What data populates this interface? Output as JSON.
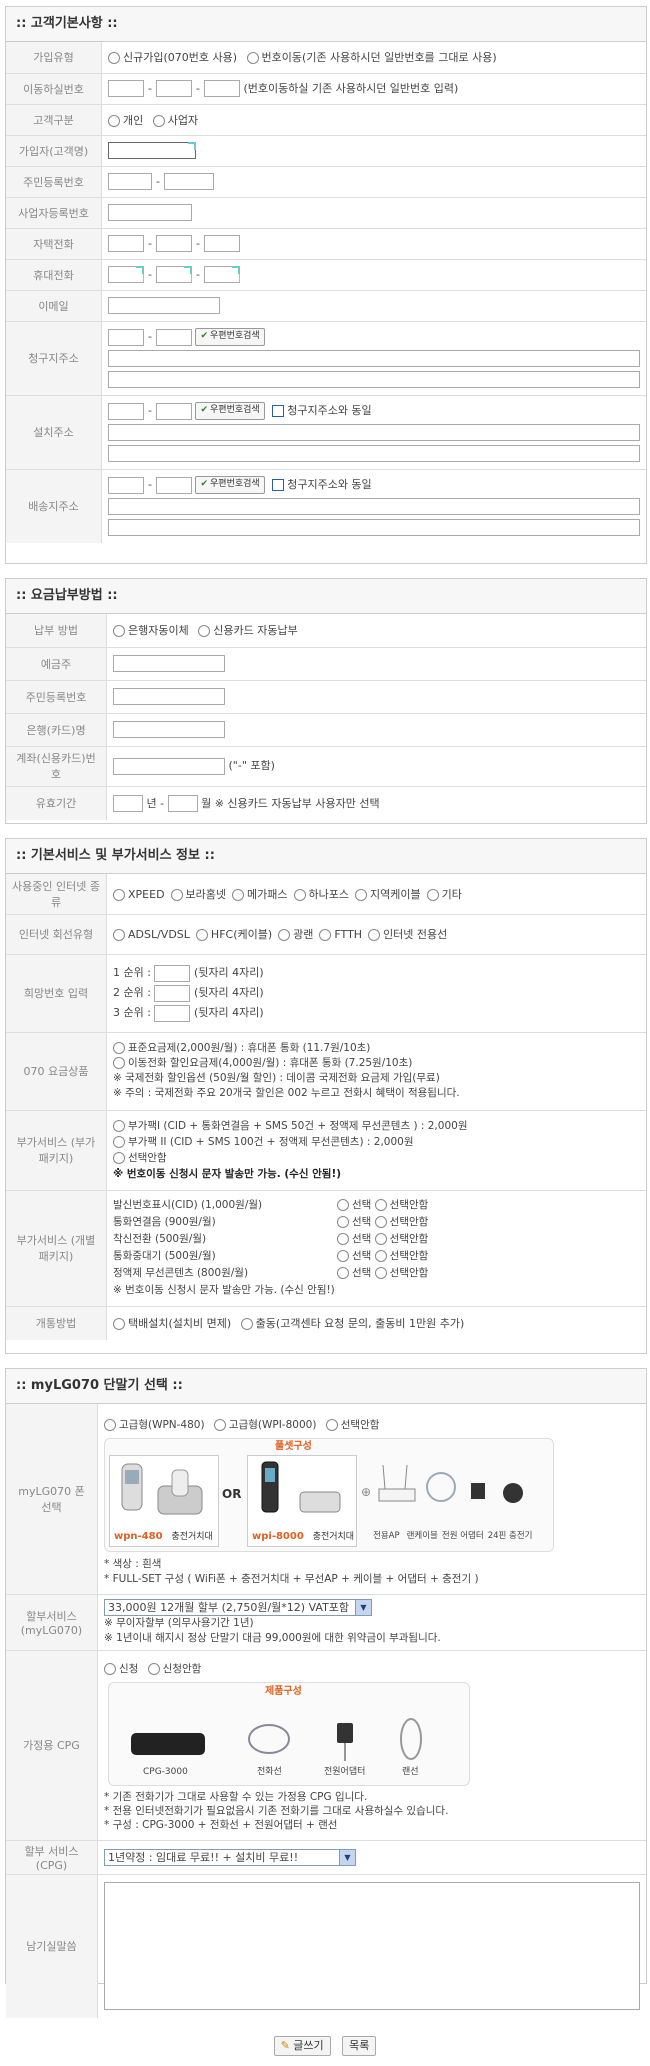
{
  "section1": {
    "title": ":: 고객기본사항 ::",
    "rows": {
      "join_type": {
        "label": "가입유형",
        "opt1": "신규가입(070번호 사용)",
        "opt2": "번호이동(기존 사용하시던 일반번호를 그대로 사용)"
      },
      "port_number": {
        "label": "이동하실번호",
        "note": "(번호이동하실 기존 사용하시던 일반번호 입력)"
      },
      "customer_type": {
        "label": "고객구분",
        "opt1": "개인",
        "opt2": "사업자"
      },
      "subscriber": {
        "label": "가입자(고객명)"
      },
      "rrn": {
        "label": "주민등록번호"
      },
      "biz_no": {
        "label": "사업자등록번호"
      },
      "home_phone": {
        "label": "자택전화"
      },
      "mobile": {
        "label": "휴대전화"
      },
      "email": {
        "label": "이메일"
      },
      "billing_addr": {
        "label": "청구지주소"
      },
      "install_addr": {
        "label": "설치주소"
      },
      "ship_addr": {
        "label": "배송지주소"
      }
    },
    "zip_button": "우편번호검색",
    "same_as_billing": "청구지주소와 동일"
  },
  "section2": {
    "title": ":: 요금납부방법 ::",
    "rows": {
      "pay_method": {
        "label": "납부 방법",
        "opt1": "은행자동이체",
        "opt2": "신용카드 자동납부"
      },
      "depositor": {
        "label": "예금주"
      },
      "rrn": {
        "label": "주민등록번호"
      },
      "bank": {
        "label": "은행(카드)명"
      },
      "account": {
        "label": "계좌(신용카드)번호",
        "note": "(\"-\" 포함)"
      },
      "valid": {
        "label": "유효기간",
        "year": "년 -",
        "month": "월",
        "note": "※ 신용카드 자동납부 사용자만 선택"
      }
    }
  },
  "section3": {
    "title": ":: 기본서비스 및 부가서비스 정보 ::",
    "rows": {
      "isp": {
        "label": "사용중인 인터넷 종류",
        "options": [
          "XPEED",
          "보라홈넷",
          "메가패스",
          "하나포스",
          "지역케이블",
          "기타"
        ]
      },
      "line_type": {
        "label": "인터넷 회선유형",
        "options": [
          "ADSL/VDSL",
          "HFC(케이블)",
          "광랜",
          "FTTH",
          "인터넷 전용선"
        ]
      },
      "wish_number": {
        "label": "희망번호 입력",
        "r1": "1 순위 :",
        "r2": "2 순위 :",
        "r3": "3 순위 :",
        "suffix": "(뒷자리 4자리)"
      },
      "plan": {
        "label": "070 요금상품",
        "opt1": "표준요금제(2,000원/월) : 휴대폰 통화 (11.7원/10초)",
        "opt2": "이동전화 할인요금제(4,000원/월) : 휴대폰 통화 (7.25원/10초)",
        "note1": "※ 국제전화 할인옵션 (50원/월 할인) : 데이콤 국제전화 요금제 가입(무료)",
        "note2": "※ 주의 : 국제전화 주요 20개국 할인은 002 누르고 전화시 혜택이 적용됩니다."
      },
      "addon_pkg": {
        "label": "부가서비스 (부가패키지)",
        "opt1": "부가팩I (CID + 통화연결음 + SMS 50건 + 정액제 무선콘텐츠 ) : 2,000원",
        "opt2": "부가팩 II (CID + SMS 100건 + 정액제 무선콘텐츠) : 2,000원",
        "opt3": "선택안함",
        "note": "※ 번호이동 신청시 문자 발송만 가능. (수신 안됨!)"
      },
      "addon_each": {
        "label": "부가서비스 (개별패키지)",
        "items": [
          "발신번호표시(CID) (1,000원/월)",
          "통화연결음 (900원/월)",
          "착신전환 (500원/월)",
          "통화중대기 (500원/월)",
          "정액제 무선콘텐츠 (800원/월)"
        ],
        "yes": "선택",
        "no": "선택안함",
        "note": "※ 번호이동 신청시 문자 발송만 가능. (수신 안됨!)"
      },
      "open_method": {
        "label": "개통방법",
        "opt1": "택배설치(설치비 면제)",
        "opt2": "출동(고객센타 요청 문의, 출동비 1만원 추가)"
      }
    }
  },
  "section4": {
    "title": ":: myLG070 단말기 선택 ::",
    "phone": {
      "label": "myLG070 폰 선택",
      "opt1": "고급형(WPN-480)",
      "opt2": "고급형(WPI-8000)",
      "opt3": "선택안함",
      "full_set": "풀셋구성",
      "or": "OR",
      "model1": "wpn-480",
      "cradle1": "충전거치대",
      "model2": "wpi-8000",
      "cradle2": "충전거치대",
      "acc": [
        "전용AP",
        "랜케이블",
        "전원 어댑터",
        "24핀 충전기"
      ],
      "note1": "* 색상 : 흰색",
      "note2": "* FULL-SET 구성 ( WiFi폰 + 충전거치대 + 무선AP + 케이블 + 어댑터 + 충전기 )"
    },
    "installment": {
      "label": "할부서비스 (myLG070)",
      "selected": "33,000원 12개월 할부 (2,750원/월*12) VAT포함",
      "note1": "※ 무이자할부 (의무사용기간 1년)",
      "note2": "※ 1년이내 해지시 정상 단말기 대금 99,000원에 대한 위약금이 부과됩니다."
    },
    "cpg": {
      "label": "가정용 CPG",
      "opt1": "신청",
      "opt2": "신청안함",
      "product_title": "제품구성",
      "items": [
        "CPG-3000",
        "전화선",
        "전원어댑터",
        "랜선"
      ],
      "note1": "* 기존 전화기가 그대로 사용할 수 있는 가정용 CPG 입니다.",
      "note2": "* 전용 인터넷전화기가 필요없음시 기존 전화기를 그대로 사용하실수 있습니다.",
      "note3": "* 구성 : CPG-3000 + 전화선 + 전원어댑터 + 랜선"
    },
    "cpg_installment": {
      "label": "할부 서비스 (CPG)",
      "selected": "1년약정 : 임대료 무료!! + 설치비 무료!!"
    },
    "memo": {
      "label": "남기실말씀"
    }
  },
  "footer": {
    "write": "글쓰기",
    "list": "목록"
  }
}
